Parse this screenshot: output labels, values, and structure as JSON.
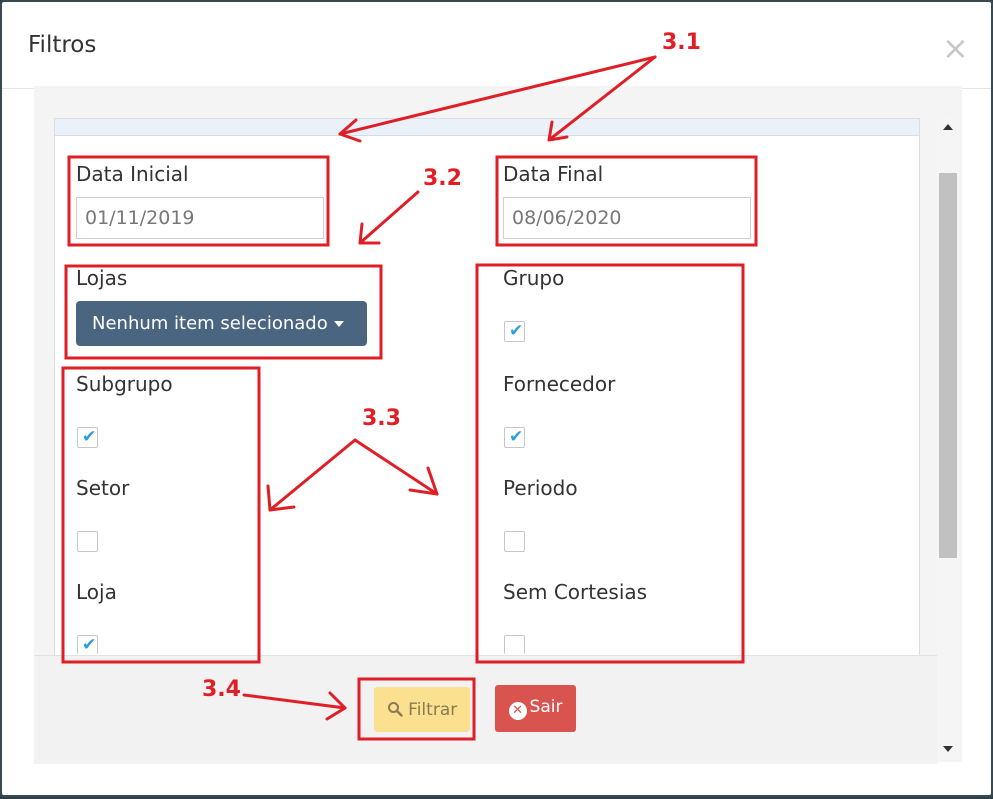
{
  "modal": {
    "title": "Filtros",
    "close_glyph": "×"
  },
  "fields": {
    "data_inicial": {
      "label": "Data Inicial",
      "value": "01/11/2019"
    },
    "data_final": {
      "label": "Data Final",
      "value": "08/06/2020"
    },
    "lojas": {
      "label": "Lojas",
      "button": "Nenhum item selecionado"
    }
  },
  "checkboxes_left": [
    {
      "label": "Subgrupo",
      "checked": true
    },
    {
      "label": "Setor",
      "checked": false
    },
    {
      "label": "Loja",
      "checked": true
    }
  ],
  "checkboxes_right": [
    {
      "label": "Grupo",
      "checked": true
    },
    {
      "label": "Fornecedor",
      "checked": true
    },
    {
      "label": "Periodo",
      "checked": false
    },
    {
      "label": "Sem Cortesias",
      "checked": false
    }
  ],
  "buttons": {
    "filtrar": "Filtrar",
    "sair": "Sair"
  },
  "annotations": {
    "a1": "3.1",
    "a2": "3.2",
    "a3": "3.3",
    "a4": "3.4"
  },
  "colors": {
    "annotation": "#e01e26",
    "check": "#2d9fd9",
    "lojas_button": "#4a6580",
    "filtrar": "#fbe08f",
    "sair": "#d9534f"
  }
}
